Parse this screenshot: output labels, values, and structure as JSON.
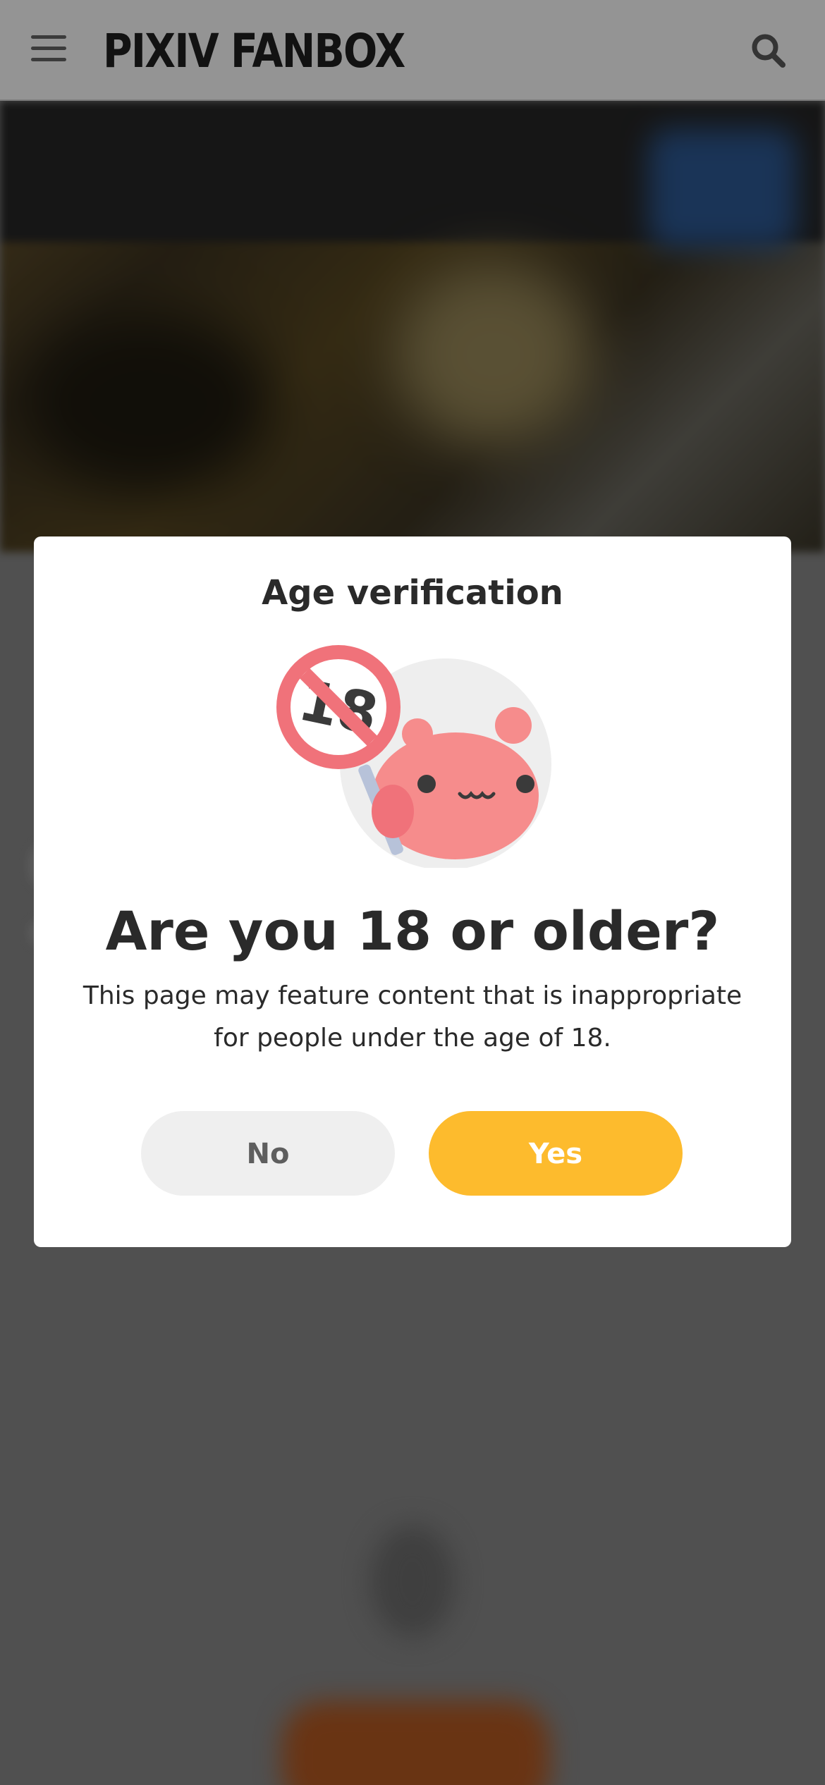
{
  "header": {
    "logo_text": "PIXIV FANBOX",
    "menu_icon": "hamburger-menu-icon",
    "search_icon": "search-icon"
  },
  "modal": {
    "title": "Age verification",
    "illustration_badge": "18",
    "question": "Are you 18 or older?",
    "description": "This page may feature content that is inappropriate for people under the age of 18.",
    "no_label": "No",
    "yes_label": "Yes"
  },
  "colors": {
    "accent_yes": "#fdbb2d",
    "no_button_bg": "#efefef",
    "prohibit_sign": "#f0727a",
    "mascot": "#f68c8c"
  }
}
